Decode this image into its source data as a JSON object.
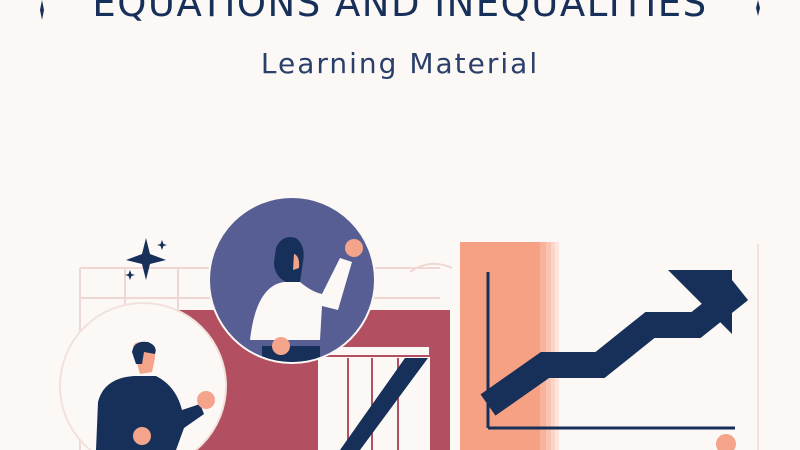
{
  "header": {
    "title": "EQUATIONS AND INEQUALITIES",
    "subtitle": "Learning Material"
  },
  "colors": {
    "background": "#fcf8f5",
    "navy": "#17305a",
    "slate_blue": "#565e93",
    "rose": "#b24f60",
    "salmon": "#f7a184",
    "peach": "#f4a48a",
    "grid": "#efd8d4"
  },
  "illustration": {
    "icons": [
      "sparkle-star-icon",
      "rising-arrow-icon",
      "woman-presenter-icon",
      "man-presenter-icon",
      "pillars-icon"
    ]
  }
}
